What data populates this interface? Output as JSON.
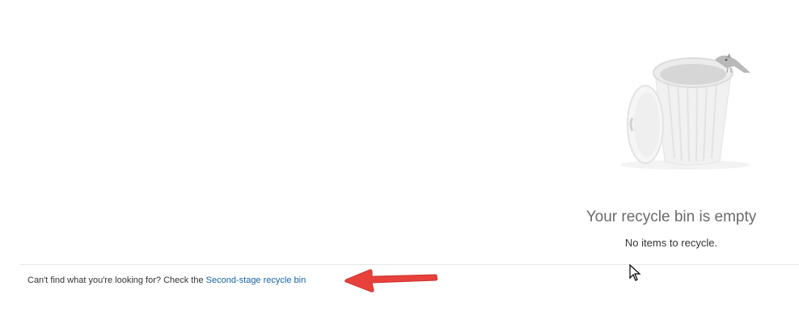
{
  "empty_state": {
    "title": "Your recycle bin is empty",
    "subtitle": "No items to recycle.",
    "illustration_icon": "recycle-bin-with-bird-illustration"
  },
  "footer": {
    "prompt_text": "Can't find what you're looking for? Check the",
    "link_text": "Second-stage recycle bin"
  },
  "annotation": {
    "arrow_icon": "red-arrow-icon",
    "arrow_color": "#e8413c"
  },
  "colors": {
    "link": "#1763a6",
    "title": "#6b6b6b",
    "divider": "#e6e6e6"
  }
}
